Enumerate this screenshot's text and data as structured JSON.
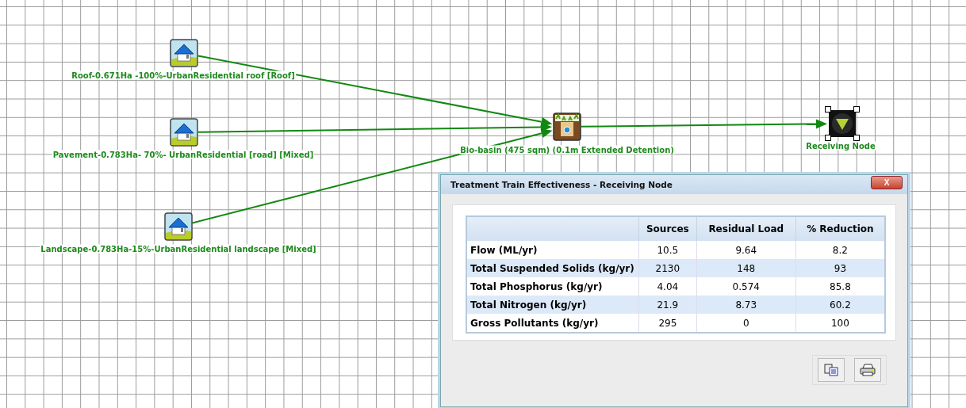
{
  "nodes": [
    {
      "kind": "source",
      "label": "Roof-0.671Ha -100%-UrbanResidential roof [Roof]",
      "selected": false
    },
    {
      "kind": "source",
      "label": "Pavement-0.783Ha- 70%- UrbanResidential [road] [Mixed]",
      "selected": false
    },
    {
      "kind": "source",
      "label": "Landscape-0.783Ha-15%-UrbanResidential landscape [Mixed]",
      "selected": false
    },
    {
      "kind": "treatment",
      "label": "Bio-basin (475 sqm) (0.1m Extended Detention)",
      "selected": false
    },
    {
      "kind": "receiving",
      "label": "Receiving Node",
      "selected": true
    }
  ],
  "dialog": {
    "title": "Treatment Train Effectiveness - Receiving Node",
    "close": "X",
    "table": {
      "columns": [
        "Sources",
        "Residual Load",
        "% Reduction"
      ],
      "rows": [
        {
          "label": "Flow (ML/yr)",
          "values": [
            "10.5",
            "9.64",
            "8.2"
          ]
        },
        {
          "label": "Total Suspended Solids (kg/yr)",
          "values": [
            "2130",
            "148",
            "93"
          ]
        },
        {
          "label": "Total Phosphorus (kg/yr)",
          "values": [
            "4.04",
            "0.574",
            "85.8"
          ]
        },
        {
          "label": "Total Nitrogen (kg/yr)",
          "values": [
            "21.9",
            "8.73",
            "60.2"
          ]
        },
        {
          "label": "Gross Pollutants (kg/yr)",
          "values": [
            "295",
            "0",
            "100"
          ]
        }
      ]
    }
  }
}
